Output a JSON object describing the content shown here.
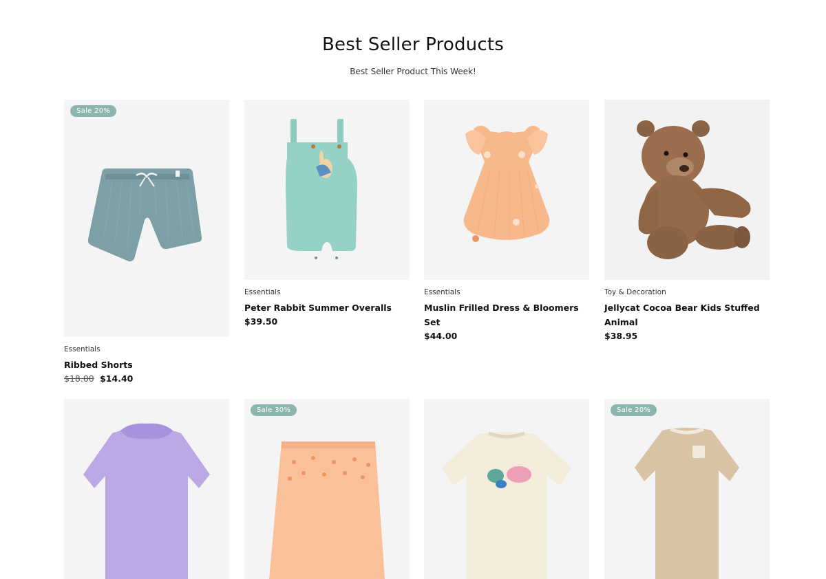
{
  "section": {
    "title": "Best Seller Products",
    "subtitle": "Best Seller Product This Week!"
  },
  "products": [
    {
      "badge": "Sale 20%",
      "category": "Essentials",
      "name": "Ribbed Shorts",
      "old_price": "$18.00",
      "price": "$14.40",
      "image": "ribbed-shorts-image"
    },
    {
      "badge": "",
      "category": "Essentials",
      "name": "Peter Rabbit Summer Overalls",
      "price": "$39.50",
      "image": "overalls-image"
    },
    {
      "badge": "",
      "category": "Essentials",
      "name": "Muslin Frilled Dress & Bloomers Set",
      "price": "$44.00",
      "image": "dress-image"
    },
    {
      "badge": "",
      "category": "Toy & Decoration",
      "name": "Jellycat Cocoa Bear Kids Stuffed Animal",
      "price": "$38.95",
      "image": "teddy-bear-image"
    },
    {
      "badge": "",
      "image": "lilac-top-image"
    },
    {
      "badge": "Sale 30%",
      "image": "peach-pants-image"
    },
    {
      "badge": "",
      "image": "cream-sweatshirt-image"
    },
    {
      "badge": "Sale 20%",
      "image": "beige-bodysuit-image"
    }
  ],
  "colors": {
    "badge_bg": "#8bb5ad",
    "card_bg": "#f4f4f4",
    "text": "#111111"
  }
}
